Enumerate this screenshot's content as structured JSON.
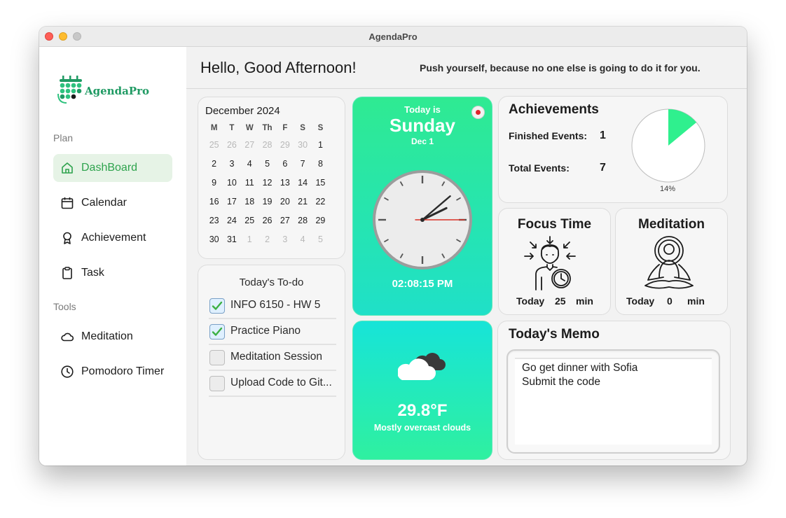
{
  "window": {
    "title": "AgendaPro"
  },
  "sidebar": {
    "logo_text": "AgendaPro",
    "sections": [
      {
        "label": "Plan"
      },
      {
        "label": "Tools"
      }
    ],
    "items": [
      {
        "label": "DashBoard",
        "icon": "home-icon",
        "active": true
      },
      {
        "label": "Calendar",
        "icon": "calendar-icon"
      },
      {
        "label": "Achievement",
        "icon": "award-icon"
      },
      {
        "label": "Task",
        "icon": "clipboard-icon"
      },
      {
        "label": "Meditation",
        "icon": "cloud-icon"
      },
      {
        "label": "Pomodoro Timer",
        "icon": "clock-icon"
      }
    ],
    "accent_color": "#2ea34d"
  },
  "header": {
    "greeting": "Hello, Good Afternoon!",
    "quote": "Push yourself, because no one else is going to do it for you."
  },
  "calendar": {
    "title": "December 2024",
    "weekdays": [
      "M",
      "T",
      "W",
      "Th",
      "F",
      "S",
      "S"
    ],
    "weeks": [
      [
        "25",
        "26",
        "27",
        "28",
        "29",
        "30",
        "1"
      ],
      [
        "2",
        "3",
        "4",
        "5",
        "6",
        "7",
        "8"
      ],
      [
        "9",
        "10",
        "11",
        "12",
        "13",
        "14",
        "15"
      ],
      [
        "16",
        "17",
        "18",
        "19",
        "20",
        "21",
        "22"
      ],
      [
        "23",
        "24",
        "25",
        "26",
        "27",
        "28",
        "29"
      ],
      [
        "30",
        "31",
        "1",
        "2",
        "3",
        "4",
        "5"
      ]
    ],
    "selected_day": "4"
  },
  "todo": {
    "title": "Today's To-do",
    "items": [
      {
        "label": "INFO 6150 - HW 5",
        "checked": true
      },
      {
        "label": "Practice Piano",
        "checked": true
      },
      {
        "label": "Meditation Session",
        "checked": false
      },
      {
        "label": "Upload Code to Git...",
        "checked": false
      }
    ]
  },
  "today": {
    "label": "Today is",
    "weekday": "Sunday",
    "date": "Dec 1",
    "time": "02:08:15 PM",
    "clock": {
      "hour": 2,
      "minute": 8,
      "second": 15
    }
  },
  "weather": {
    "temperature": "29.8°F",
    "description": "Mostly overcast clouds",
    "icon": "cloud-icon"
  },
  "achievements": {
    "title": "Achievements",
    "finished_label": "Finished Events:",
    "finished_value": "1",
    "total_label": "Total Events:",
    "total_value": "7",
    "percent_label": "14%",
    "progress": 0.14,
    "accent_color": "#2ff08e"
  },
  "focus": {
    "title": "Focus Time",
    "today_label": "Today",
    "value": "25",
    "unit": "min"
  },
  "meditation": {
    "title": "Meditation",
    "today_label": "Today",
    "value": "0",
    "unit": "min"
  },
  "memo": {
    "title": "Today's Memo",
    "lines": [
      "Go get dinner with Sofia",
      "Submit the code"
    ]
  }
}
